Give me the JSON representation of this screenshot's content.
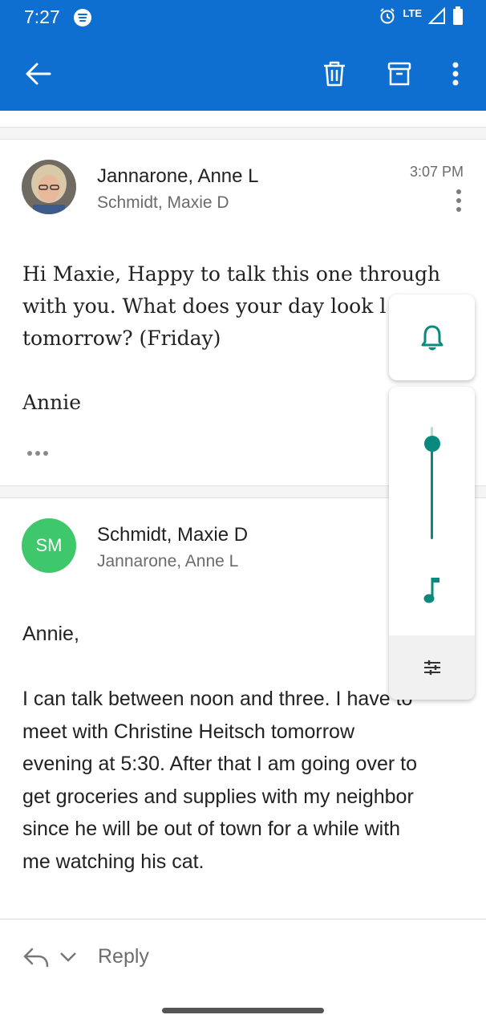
{
  "status_bar": {
    "time": "7:27",
    "network": "LTE"
  },
  "toolbar": {
    "back_icon": "arrow-left-icon",
    "delete_icon": "trash-icon",
    "archive_icon": "archive-icon",
    "more_icon": "more-vert-icon"
  },
  "messages": [
    {
      "sender": "Jannarone, Anne L",
      "recipient": "Schmidt, Maxie D",
      "time": "3:07 PM",
      "body_lines": [
        "Hi Maxie, Happy to talk this one through",
        "with you. What does your day look l",
        "tomorrow? (Friday)",
        "",
        "Annie"
      ]
    },
    {
      "sender": "Schmidt, Maxie D",
      "recipient": "Jannarone, Anne L",
      "initials": "SM",
      "avatar_color": "#3ec76b",
      "body_lines": [
        "Annie,",
        "",
        "I can talk between noon and three. I have to",
        "meet with Christine Heitsch tomorrow",
        "evening at 5:30. After that I am going over to",
        "get groceries and supplies with my neighbor",
        "since he will be out of town for a while with",
        "me watching his cat."
      ]
    }
  ],
  "volume_panel": {
    "ring_icon": "bell-icon",
    "media_icon": "music-note-icon",
    "settings_icon": "sliders-icon",
    "level": 0.85,
    "accent": "#0a8a7d"
  },
  "reply": {
    "label": "Reply",
    "reply_icon": "reply-icon",
    "chevron_icon": "chevron-down-icon"
  },
  "colors": {
    "header": "#0f6fd0"
  }
}
